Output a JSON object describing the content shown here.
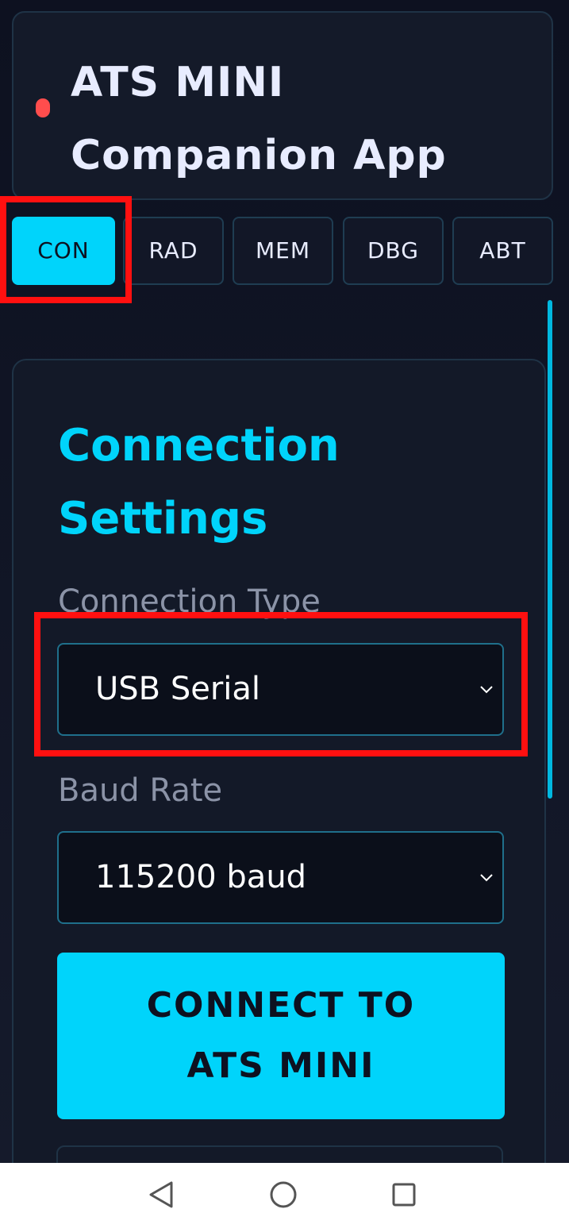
{
  "header": {
    "title_line1": "ATS MINI",
    "title_line2": "Companion App",
    "status_color": "#ff4d4d"
  },
  "tabs": [
    {
      "label": "CON",
      "active": true
    },
    {
      "label": "RAD",
      "active": false
    },
    {
      "label": "MEM",
      "active": false
    },
    {
      "label": "DBG",
      "active": false
    },
    {
      "label": "ABT",
      "active": false
    }
  ],
  "connection": {
    "title": "Connection Settings",
    "type_label": "Connection Type",
    "type_value": "USB Serial",
    "baud_label": "Baud Rate",
    "baud_value": "115200 baud",
    "connect_label": "CONNECT TO ATS MINI"
  },
  "colors": {
    "accent": "#00d4fb",
    "background": "#0e1220",
    "highlight": "#ff1010"
  },
  "icons": {
    "select_chevron": "chevron-down-icon",
    "nav_back": "back-triangle-icon",
    "nav_home": "home-circle-icon",
    "nav_recents": "recents-square-icon"
  }
}
